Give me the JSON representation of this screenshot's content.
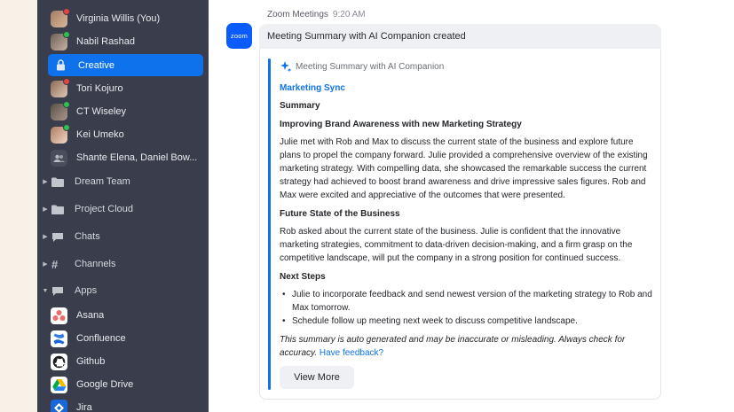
{
  "sidebar": {
    "contacts": [
      {
        "name": "Virginia Willis (You)",
        "status": "red"
      },
      {
        "name": "Nabil Rashad",
        "status": "green"
      }
    ],
    "active_item": {
      "label": "Creative",
      "icon": "lock-icon"
    },
    "contacts2": [
      {
        "name": "Tori Kojuro",
        "status": "red"
      },
      {
        "name": "CT Wiseley",
        "status": "green"
      },
      {
        "name": "Kei Umeko",
        "status": "green"
      },
      {
        "name": "Shante Elena, Daniel Bow...",
        "status": ""
      }
    ],
    "sections": [
      {
        "label": "Dream Team",
        "icon": "folder-icon"
      },
      {
        "label": "Project Cloud",
        "icon": "folder-icon"
      },
      {
        "label": "Chats",
        "icon": "chat-bubble-icon"
      },
      {
        "label": "Channels",
        "icon": "hash-icon"
      },
      {
        "label": "Apps",
        "icon": "chat-bubble-icon"
      }
    ],
    "apps": [
      {
        "label": "Asana",
        "color": "#f06a6a"
      },
      {
        "label": "Confluence",
        "color": "#1868db"
      },
      {
        "label": "Github",
        "color": "#ffffff"
      },
      {
        "label": "Google Drive",
        "color": "#ffffff"
      },
      {
        "label": "Jira",
        "color": "#1868db"
      }
    ]
  },
  "message": {
    "bot_logo": "zoom",
    "sender": "Zoom Meetings",
    "time": "9:20 AM",
    "headline": "Meeting Summary with AI Companion created",
    "card": {
      "header": "Meeting Summary with AI Companion",
      "meeting_title": "Marketing Sync",
      "summary_heading": "Summary",
      "section1_title": "Improving Brand Awareness with new Marketing Strategy",
      "section1_body": "Julie met with Rob and Max to discuss the current state of the business and explore future plans to propel the company forward. Julie provided a comprehensive overview of the existing marketing strategy. With compelling data, she showcased the remarkable success the current strategy had achieved to boost brand awareness and drive impressive sales figures. Rob and Max were excited and appreciative of the outcomes that were presented.",
      "section2_title": "Future State of the Business",
      "section2_body": "Rob asked about the current state of the business. Julie is confident that the innovative marketing strategies, commitment to data-driven decision-making, and a firm grasp on the competitive landscape, will put the company in a strong position for continued success.",
      "next_steps_title": "Next Steps",
      "next_steps": [
        "Julie to incorporate feedback and send newest version of the marketing strategy to Rob and Max tomorrow.",
        "Schedule follow up meeting next week to discuss competitive landscape."
      ],
      "disclaimer": "This summary is auto generated and may be inaccurate or misleading. Always check for accuracy.",
      "feedback_link": "Have feedback?",
      "view_more": "View More"
    }
  },
  "colors": {
    "accent": "#0e72ed",
    "sidebar_bg": "#3a3d4c"
  }
}
